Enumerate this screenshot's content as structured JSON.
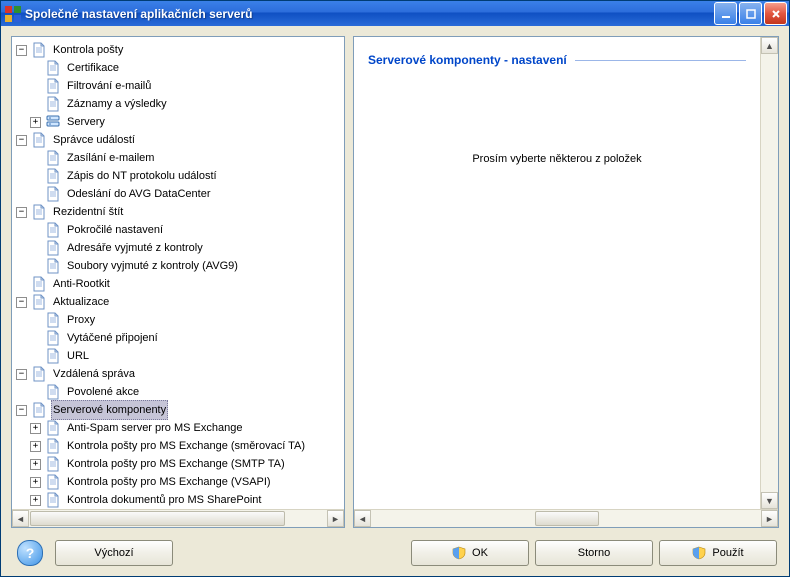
{
  "title": "Společné nastavení aplikačních serverů",
  "panel": {
    "heading": "Serverové komponenty - nastavení",
    "message": "Prosím vyberte některou z položek"
  },
  "buttons": {
    "default": "Výchozí",
    "ok": "OK",
    "cancel": "Storno",
    "apply": "Použít"
  },
  "tree": [
    {
      "label": "Kontrola pošty",
      "exp": "minus",
      "children": [
        {
          "label": "Certifikace",
          "exp": "none"
        },
        {
          "label": "Filtrování e-mailů",
          "exp": "none"
        },
        {
          "label": "Záznamy a výsledky",
          "exp": "none"
        },
        {
          "label": "Servery",
          "exp": "plus",
          "iconVariant": "servers"
        }
      ]
    },
    {
      "label": "Správce událostí",
      "exp": "minus",
      "children": [
        {
          "label": "Zasílání e-mailem",
          "exp": "none"
        },
        {
          "label": "Zápis do NT protokolu událostí",
          "exp": "none"
        },
        {
          "label": "Odeslání do AVG DataCenter",
          "exp": "none"
        }
      ]
    },
    {
      "label": "Rezidentní štít",
      "exp": "minus",
      "children": [
        {
          "label": "Pokročilé nastavení",
          "exp": "none"
        },
        {
          "label": "Adresáře vyjmuté z kontroly",
          "exp": "none"
        },
        {
          "label": "Soubory vyjmuté z kontroly (AVG9)",
          "exp": "none"
        }
      ]
    },
    {
      "label": "Anti-Rootkit",
      "exp": "none"
    },
    {
      "label": "Aktualizace",
      "exp": "minus",
      "children": [
        {
          "label": "Proxy",
          "exp": "none"
        },
        {
          "label": "Vytáčené připojení",
          "exp": "none"
        },
        {
          "label": "URL",
          "exp": "none"
        }
      ]
    },
    {
      "label": "Vzdálená správa",
      "exp": "minus",
      "children": [
        {
          "label": "Povolené akce",
          "exp": "none"
        }
      ]
    },
    {
      "label": "Serverové komponenty",
      "exp": "minus",
      "selected": true,
      "children": [
        {
          "label": "Anti-Spam server pro MS Exchange",
          "exp": "plus"
        },
        {
          "label": "Kontrola pošty pro MS Exchange (směrovací TA)",
          "exp": "plus"
        },
        {
          "label": "Kontrola pošty pro MS Exchange (SMTP TA)",
          "exp": "plus"
        },
        {
          "label": "Kontrola pošty pro MS Exchange (VSAPI)",
          "exp": "plus"
        },
        {
          "label": "Kontrola dokumentů pro MS SharePoint",
          "exp": "plus"
        }
      ]
    }
  ]
}
